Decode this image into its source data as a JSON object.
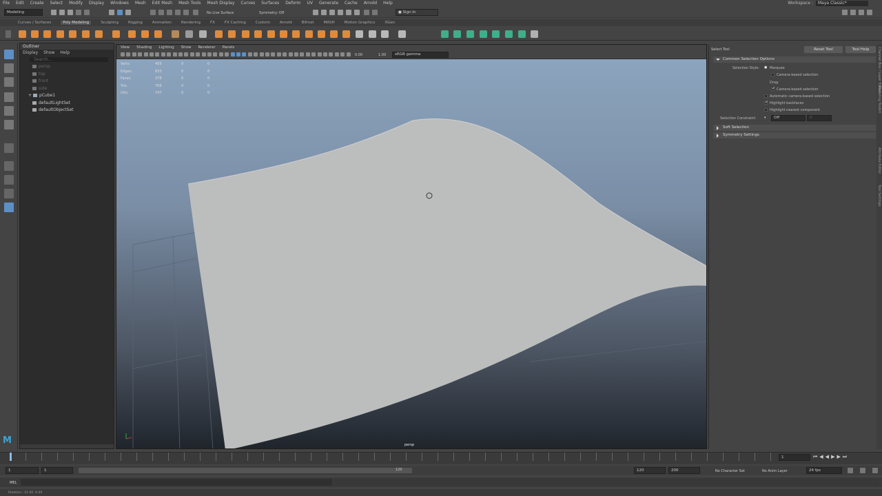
{
  "menus": [
    "File",
    "Edit",
    "Create",
    "Select",
    "Modify",
    "Display",
    "Windows",
    "Mesh",
    "Edit Mesh",
    "Mesh Tools",
    "Mesh Display",
    "Curves",
    "Surfaces",
    "Deform",
    "UV",
    "Generate",
    "Cache",
    "Arnold",
    "Help"
  ],
  "workspace": {
    "label": "Workspace :",
    "value": "Maya Classic*"
  },
  "status": {
    "mode": "Modeling",
    "live_surface": "No Live Surface",
    "symmetry": "Symmetry: Off",
    "sign_in": "Sign In"
  },
  "shelf_tabs": [
    "Curves / Surfaces",
    "Poly Modeling",
    "Sculpting",
    "Rigging",
    "Animation",
    "Rendering",
    "FX",
    "FX Caching",
    "Custom",
    "Arnold",
    "Bifrost",
    "MASH",
    "Motion Graphics",
    "XGen"
  ],
  "shelf_active": "Poly Modeling",
  "outliner": {
    "title": "Outliner",
    "menu": [
      "Display",
      "Show",
      "Help"
    ],
    "search_placeholder": "Search...",
    "items": [
      {
        "label": "persp",
        "dim": true
      },
      {
        "label": "top",
        "dim": true
      },
      {
        "label": "front",
        "dim": true
      },
      {
        "label": "side",
        "dim": true
      },
      {
        "label": "pCube1",
        "dim": false
      },
      {
        "label": "defaultLightSet",
        "dim": false
      },
      {
        "label": "defaultObjectSet",
        "dim": false
      }
    ]
  },
  "viewport": {
    "menu": [
      "View",
      "Shading",
      "Lighting",
      "Show",
      "Renderer",
      "Panels"
    ],
    "exposure": "0.00",
    "gamma": "1.00",
    "color_space": "sRGB gamma",
    "camera": "persp",
    "stats": [
      {
        "label": "Verts:",
        "v1": "459",
        "v2": "0",
        "v3": "0"
      },
      {
        "label": "Edges:",
        "v1": "833",
        "v2": "0",
        "v3": "0"
      },
      {
        "label": "Faces:",
        "v1": "378",
        "v2": "0",
        "v3": "0"
      },
      {
        "label": "Tris:",
        "v1": "756",
        "v2": "0",
        "v3": "0"
      },
      {
        "label": "UVs:",
        "v1": "747",
        "v2": "0",
        "v3": "0"
      }
    ]
  },
  "attr": {
    "title": "Select Tool",
    "reset": "Reset Tool",
    "help": "Tool Help",
    "section1": "Common Selection Options",
    "selection_style_label": "Selection Style:",
    "marquee": "Marquee",
    "camera_based1": "Camera-based selection",
    "drag": "Drag",
    "camera_based2": "Camera-based selection",
    "auto_camera": "Automatic camera-based selection",
    "highlight_back": "Highlight backfaces",
    "highlight_nearest": "Highlight nearest component",
    "constraint_label": "Selection Constraint:",
    "constraint_value": "Off",
    "constraint_num": "0",
    "section2": "Soft Selection",
    "section3": "Symmetry Settings"
  },
  "side_tabs": [
    "Channel Box / Layer Editor",
    "Modeling Toolkit",
    "Attribute Editor",
    "Tool Settings"
  ],
  "range": {
    "start": "1",
    "start2": "1",
    "mid": "120",
    "end1": "120",
    "end2": "200",
    "char_set": "No Character Set",
    "anim_layer": "No Anim Layer",
    "fps": "24 fps",
    "current": "1"
  },
  "cmd": {
    "lang": "MEL"
  },
  "help_text": "Rotation: -21.00   -0.40"
}
